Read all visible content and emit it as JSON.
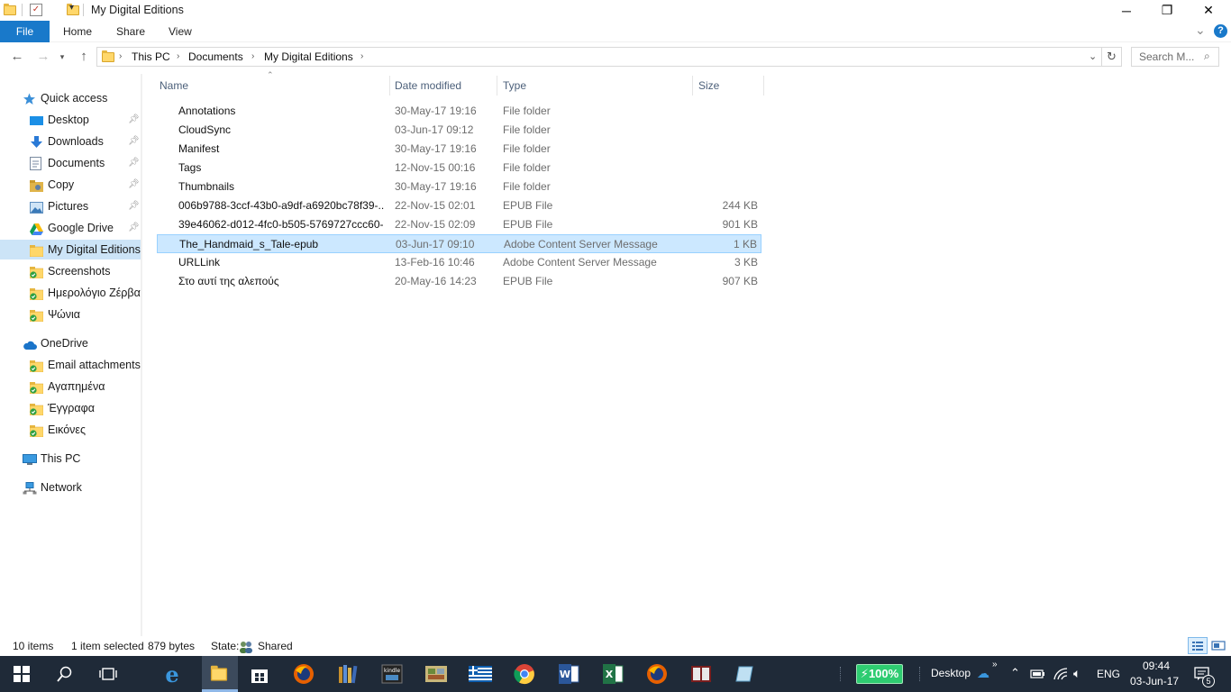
{
  "window": {
    "title": "My Digital Editions",
    "minimize": "─",
    "maximize": "❐",
    "close": "✕"
  },
  "ribbon": {
    "tabs": [
      "File",
      "Home",
      "Share",
      "View"
    ],
    "expand": "⌄",
    "help": "?"
  },
  "address": {
    "crumbs": [
      "This PC",
      "Documents",
      "My Digital Editions"
    ],
    "search_placeholder": "Search M..."
  },
  "sidebar": {
    "quick_access": "Quick access",
    "quick_items": [
      {
        "label": "Desktop",
        "pinned": true
      },
      {
        "label": "Downloads",
        "pinned": true
      },
      {
        "label": "Documents",
        "pinned": true
      },
      {
        "label": "Copy",
        "pinned": true
      },
      {
        "label": "Pictures",
        "pinned": true
      },
      {
        "label": "Google Drive",
        "pinned": true
      },
      {
        "label": "My Digital Editions",
        "pinned": false
      },
      {
        "label": "Screenshots",
        "pinned": false
      },
      {
        "label": "Ημερολόγιο Ζέρβα",
        "pinned": false
      },
      {
        "label": "Ψώνια",
        "pinned": false
      }
    ],
    "onedrive": "OneDrive",
    "onedrive_items": [
      "Email attachments",
      "Αγαπημένα",
      "Έγγραφα",
      "Εικόνες"
    ],
    "this_pc": "This PC",
    "network": "Network"
  },
  "columns": {
    "name": "Name",
    "date": "Date modified",
    "type": "Type",
    "size": "Size"
  },
  "files": [
    {
      "name": "Annotations",
      "date": "30-May-17 19:16",
      "type": "File folder",
      "size": "",
      "kind": "folder"
    },
    {
      "name": "CloudSync",
      "date": "03-Jun-17 09:12",
      "type": "File folder",
      "size": "",
      "kind": "folder"
    },
    {
      "name": "Manifest",
      "date": "30-May-17 19:16",
      "type": "File folder",
      "size": "",
      "kind": "folder"
    },
    {
      "name": "Tags",
      "date": "12-Nov-15 00:16",
      "type": "File folder",
      "size": "",
      "kind": "folder"
    },
    {
      "name": "Thumbnails",
      "date": "30-May-17 19:16",
      "type": "File folder",
      "size": "",
      "kind": "folder"
    },
    {
      "name": "006b9788-3ccf-43b0-a9df-a6920bc78f39-...",
      "date": "22-Nov-15 02:01",
      "type": "EPUB File",
      "size": "244 KB",
      "kind": "epub"
    },
    {
      "name": "39e46062-d012-4fc0-b505-5769727ccc60-...",
      "date": "22-Nov-15 02:09",
      "type": "EPUB File",
      "size": "901 KB",
      "kind": "epub"
    },
    {
      "name": "The_Handmaid_s_Tale-epub",
      "date": "03-Jun-17 09:10",
      "type": "Adobe Content Server Message",
      "size": "1 KB",
      "kind": "msg",
      "selected": true
    },
    {
      "name": "URLLink",
      "date": "13-Feb-16 10:46",
      "type": "Adobe Content Server Message",
      "size": "3 KB",
      "kind": "msg"
    },
    {
      "name": "Στο αυτί της αλεπούς",
      "date": "20-May-16 14:23",
      "type": "EPUB File",
      "size": "907 KB",
      "kind": "epub"
    }
  ],
  "status": {
    "count": "10 items",
    "selected": "1 item selected",
    "bytes": "879 bytes",
    "state_label": "State:",
    "state_value": "Shared"
  },
  "taskbar": {
    "battery": "100%",
    "desktop": "Desktop",
    "lang": "ENG",
    "time": "09:44",
    "date": "03-Jun-17",
    "notif_count": "5"
  }
}
